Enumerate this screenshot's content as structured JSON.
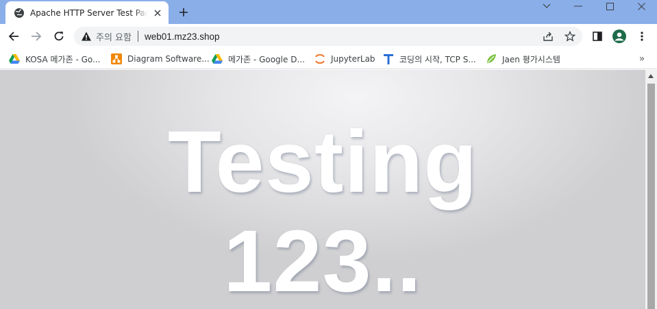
{
  "browser": {
    "tab": {
      "title": "Apache HTTP Server Test Page powered by: Rocky Linux",
      "favicon": "globe-icon"
    },
    "address_bar": {
      "security_label": "주의 요함",
      "url": "web01.mz23.shop"
    },
    "bookmarks": [
      {
        "label": "KOSA 메가존 - Go...",
        "icon": "google-drive-icon"
      },
      {
        "label": "Diagram Software...",
        "icon": "diagrams-icon"
      },
      {
        "label": "메가존 - Google D...",
        "icon": "google-drive-icon"
      },
      {
        "label": "JupyterLab",
        "icon": "jupyter-icon"
      },
      {
        "label": "코딩의 시작, TCP S...",
        "icon": "tcp-school-icon"
      },
      {
        "label": "Jaen 평가시스템",
        "icon": "jaen-icon"
      }
    ],
    "bookmarks_overflow": "»"
  },
  "page": {
    "headline_line1": "Testing",
    "headline_line2": "123.."
  },
  "colors": {
    "tabstrip": "#8aaee8",
    "profile_avatar": "#1e6b4a",
    "content_background": "#e6e6e8"
  }
}
